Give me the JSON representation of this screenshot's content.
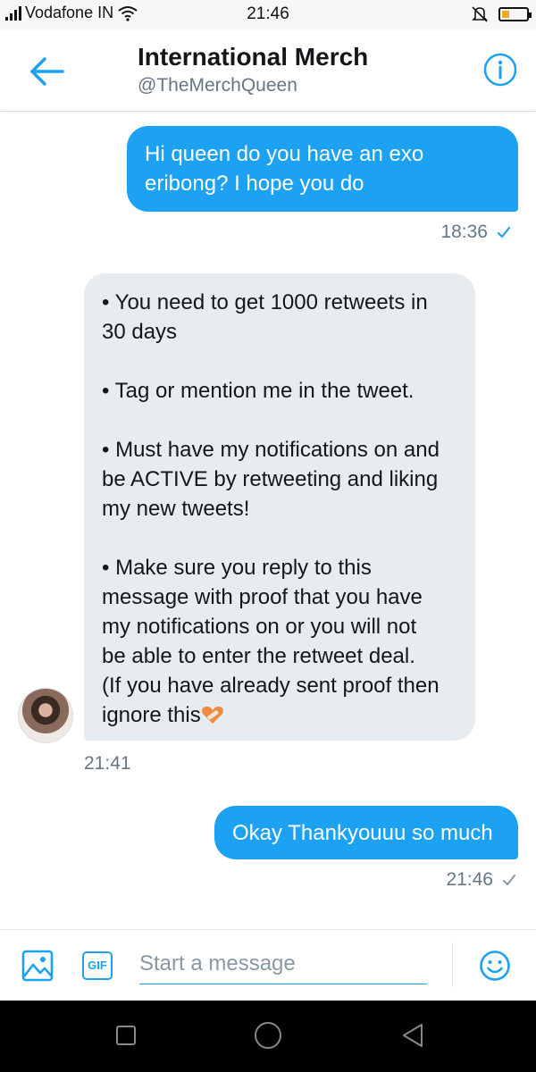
{
  "status_bar": {
    "carrier": "Vodafone IN",
    "time": "21:46",
    "icons": [
      "signal-icon",
      "wifi-icon",
      "mute-icon",
      "battery-icon"
    ]
  },
  "header": {
    "title": "International Merch",
    "handle": "@TheMerchQueen",
    "back_icon": "back-arrow-icon",
    "info_icon": "info-icon"
  },
  "messages": [
    {
      "direction": "outgoing",
      "lines": [
        "Hi queen do you have an exo",
        "eribong?  I hope you do"
      ],
      "time": "18:36",
      "read": true
    },
    {
      "direction": "incoming",
      "lines": [
        "• You need to get 1000 retweets in",
        "30 days",
        "",
        "• Tag or mention me in the tweet.",
        "",
        "• Must have my notifications on and",
        "be ACTIVE by retweeting and liking",
        "my new tweets!",
        "",
        "• Make sure you reply to this",
        "message with proof that you have",
        "my notifications on or you will not",
        "be able to enter the retweet deal.",
        "(If you have already sent proof then",
        "ignore this"
      ],
      "emoji": "heart-with-bandage-emoji",
      "time": "21:41"
    },
    {
      "direction": "outgoing",
      "lines": [
        "Okay Thankyouuu so much"
      ],
      "time": "21:46",
      "read": false
    }
  ],
  "composer": {
    "placeholder": "Start a message",
    "gif_label": "GIF",
    "image_icon": "image-icon",
    "emoji_icon": "emoji-icon"
  },
  "colors": {
    "accent": "#1da1f2",
    "incoming_bubble": "#e6ecf0",
    "secondary_text": "#657786"
  }
}
